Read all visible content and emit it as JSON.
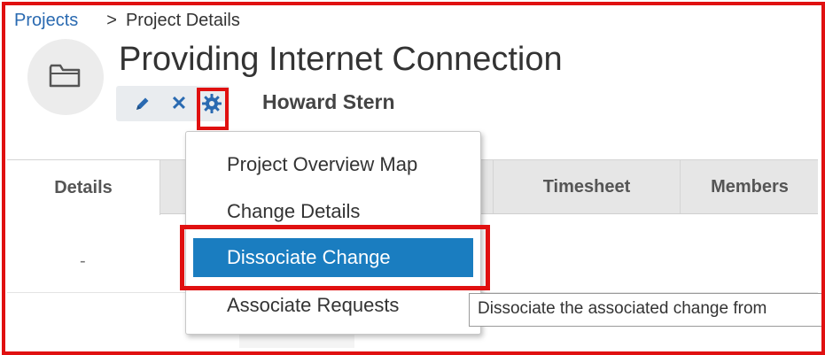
{
  "breadcrumb": {
    "link": "Projects",
    "separator": ">",
    "current": "Project Details"
  },
  "project": {
    "title": "Providing Internet Connection",
    "owner": "Howard Stern"
  },
  "icons": {
    "folder": "folder-icon",
    "edit": "pencil-icon",
    "close": "close-icon",
    "settings": "gear-icon",
    "close_glyph": "✕"
  },
  "tabs": [
    {
      "label": "Details",
      "active": true
    },
    {
      "label": "Timesheet",
      "active": false
    },
    {
      "label": "Members",
      "active": false
    }
  ],
  "details_value": "-",
  "menu": {
    "items": [
      {
        "label": "Project Overview Map"
      },
      {
        "label": "Change Details"
      },
      {
        "label": "Dissociate Change",
        "highlighted": true
      },
      {
        "label": "Associate Requests"
      }
    ]
  },
  "tooltip": "Dissociate the associated change from",
  "colors": {
    "accent": "#1a7dc0",
    "link": "#2a6ab1",
    "annotation": "#e01010"
  }
}
